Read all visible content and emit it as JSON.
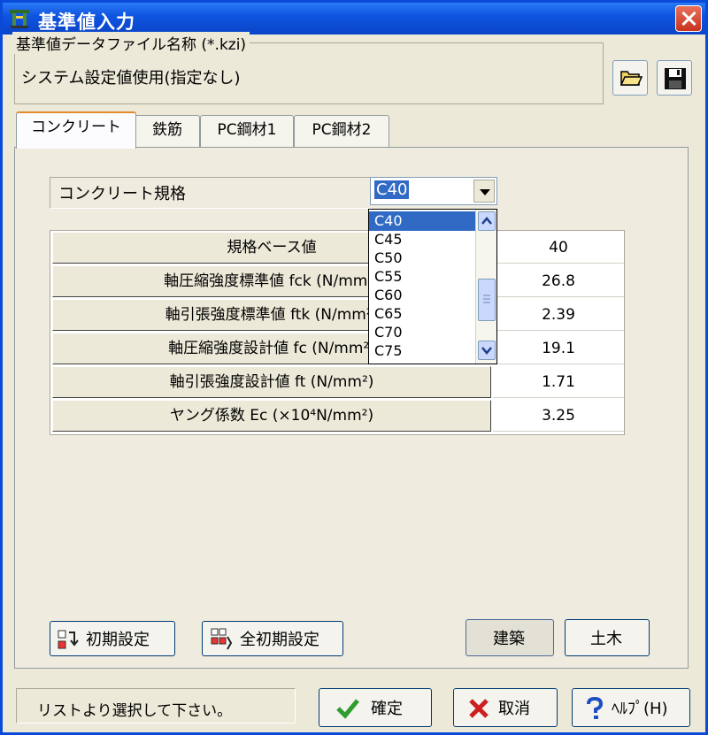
{
  "window": {
    "title": "基準値入力",
    "close_icon": "close-icon"
  },
  "file_group": {
    "legend": "基準値データファイル名称 (*.kzi)",
    "value": "システム設定値使用(指定なし)",
    "open_icon": "folder-open-icon",
    "save_icon": "save-disk-icon"
  },
  "tabs": [
    {
      "label": "コンクリート",
      "active": true
    },
    {
      "label": "鉄筋",
      "active": false
    },
    {
      "label": "PC鋼材1",
      "active": false
    },
    {
      "label": "PC鋼材2",
      "active": false
    }
  ],
  "concrete": {
    "spec_label": "コンクリート規格",
    "selected": "C40",
    "options": [
      "C40",
      "C45",
      "C50",
      "C55",
      "C60",
      "C65",
      "C70",
      "C75"
    ]
  },
  "params": [
    {
      "label": "規格ベース値",
      "value": "40"
    },
    {
      "label": "軸圧縮強度標準値 fck (N/mm²)",
      "value": "26.8"
    },
    {
      "label": "軸引張強度標準値 ftk (N/mm²)",
      "value": "2.39"
    },
    {
      "label": "軸圧縮強度設計値 fc (N/mm²)",
      "value": "19.1"
    },
    {
      "label": "軸引張強度設計値 ft (N/mm²)",
      "value": "1.71"
    },
    {
      "label": "ヤング係数 Ec (×10⁴N/mm²)",
      "value": "3.25"
    }
  ],
  "buttons": {
    "initial": "初期設定",
    "all_initial": "全初期設定",
    "building": "建築",
    "civil": "土木",
    "ok": "確定",
    "cancel": "取消",
    "help": "ﾍﾙﾌﾟ(H)"
  },
  "status": "リストより選択して下さい。",
  "colors": {
    "titlebar": "#0f55e0",
    "selection": "#316ac5",
    "cancel_red": "#cc1f1f",
    "ok_green": "#2e9c2e",
    "help_blue": "#1d4fc4"
  }
}
